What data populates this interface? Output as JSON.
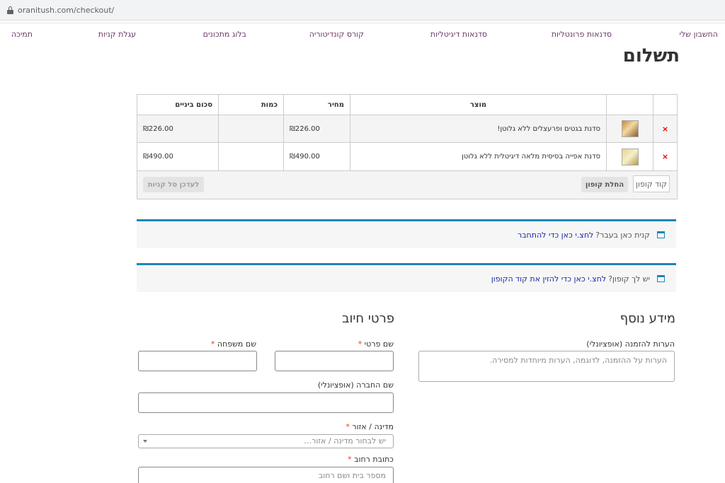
{
  "browser": {
    "url": "oranitush.com/checkout/"
  },
  "nav": {
    "items": [
      "החשבון שלי",
      "סדנאות פרונטליות",
      "סדנאות דיגיטליות",
      "קורס קונדיטוריה",
      "בלוג מתכונים",
      "עגלת קניות",
      "תמיכה"
    ]
  },
  "page": {
    "title": "תשלום"
  },
  "cart": {
    "headers": {
      "product": "מוצר",
      "price": "מחיר",
      "quantity": "כמות",
      "subtotal": "סכום ביניים"
    },
    "rows": [
      {
        "name": "סדנת בגטים ופרעצלים ללא גלוטן!",
        "price": "₪226.00",
        "subtotal": "₪226.00"
      },
      {
        "name": "סדנת אפייה בסיסית מלאה דיגיטלית ללא גלוטן",
        "price": "₪490.00",
        "subtotal": "₪490.00"
      }
    ],
    "coupon_placeholder": "קוד קופון",
    "apply_coupon": "החלת קופון",
    "update_cart": "לעדכן סל קניות",
    "remove_symbol": "×"
  },
  "notices": {
    "login_text": "קנית כאן בעבר?",
    "login_link": "לחצ.י כאן כדי להתחבר",
    "coupon_text": "יש לך קופון?",
    "coupon_link": "לחצ.י כאן כדי להזין את קוד הקופון"
  },
  "billing": {
    "heading": "פרטי חיוב",
    "first_name": "שם פרטי",
    "last_name": "שם משפחה",
    "company": "שם החברה (אופציונלי)",
    "country": "מדינה / אזור",
    "country_placeholder": "יש לבחור מדינה / אזור…",
    "street": "כתובת רחוב",
    "street_placeholder": "מספר בית ושם רחוב",
    "required_mark": "*"
  },
  "additional": {
    "heading": "מידע נוסף",
    "notes_label": "הערות להזמנה (אופציונלי)",
    "notes_placeholder": "הערות על ההזמנה, לדוגמה, הערות מיוחדות למסירה."
  },
  "colors": {
    "accent": "#1e85be",
    "nav_link": "#6b3b6a",
    "required": "#e2401c",
    "remove": "#ee0000"
  }
}
